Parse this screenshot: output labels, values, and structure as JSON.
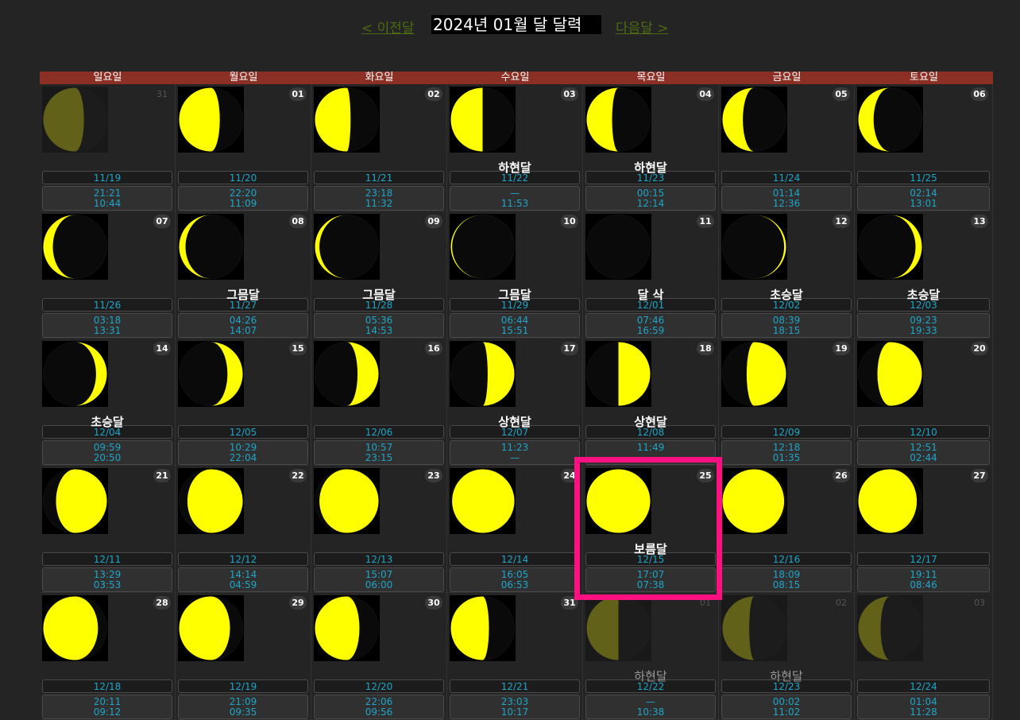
{
  "nav": {
    "prev_label": "< 이전달",
    "title": "2024년 01월 달 달력",
    "next_label": "다음달 >"
  },
  "colors": {
    "moon_lit": "#ffff00",
    "moon_dark": "#0a0a0a",
    "header_bg": "#8c3026",
    "text_accent": "#1fa5c7",
    "highlight": "#ff1080"
  },
  "weekdays": [
    "일요일",
    "월요일",
    "화요일",
    "수요일",
    "목요일",
    "금요일",
    "토요일"
  ],
  "weeks": [
    [
      {
        "day": "31",
        "other": true,
        "lunar": "11/19",
        "rise": "21:21",
        "set": "10:44",
        "phase": "",
        "lit": 0.64,
        "waxing": false
      },
      {
        "day": "01",
        "lunar": "11/20",
        "rise": "22:20",
        "set": "11:09",
        "phase": "",
        "lit": 0.64,
        "waxing": false
      },
      {
        "day": "02",
        "lunar": "11/21",
        "rise": "23:18",
        "set": "11:32",
        "phase": "",
        "lit": 0.56,
        "waxing": false
      },
      {
        "day": "03",
        "lunar": "11/22",
        "rise": "—",
        "set": "11:53",
        "phase": "하현달",
        "lit": 0.5,
        "waxing": false
      },
      {
        "day": "04",
        "lunar": "11/23",
        "rise": "00:15",
        "set": "12:14",
        "phase": "하현달",
        "lit": 0.4,
        "waxing": false
      },
      {
        "day": "05",
        "lunar": "11/24",
        "rise": "01:14",
        "set": "12:36",
        "phase": "",
        "lit": 0.32,
        "waxing": false
      },
      {
        "day": "06",
        "lunar": "11/25",
        "rise": "02:14",
        "set": "13:01",
        "phase": "",
        "lit": 0.24,
        "waxing": false
      }
    ],
    [
      {
        "day": "07",
        "lunar": "11/26",
        "rise": "03:18",
        "set": "13:31",
        "phase": "",
        "lit": 0.15,
        "waxing": false
      },
      {
        "day": "08",
        "lunar": "11/27",
        "rise": "04:26",
        "set": "14:07",
        "phase": "그믐달",
        "lit": 0.1,
        "waxing": false
      },
      {
        "day": "09",
        "lunar": "11/28",
        "rise": "05:36",
        "set": "14:53",
        "phase": "그믐달",
        "lit": 0.07,
        "waxing": false
      },
      {
        "day": "10",
        "lunar": "11/29",
        "rise": "06:44",
        "set": "15:51",
        "phase": "그믐달",
        "lit": 0.02,
        "waxing": false
      },
      {
        "day": "11",
        "lunar": "12/01",
        "rise": "07:46",
        "set": "16:59",
        "phase": "달 삭",
        "lit": 0,
        "waxing": true
      },
      {
        "day": "12",
        "lunar": "12/02",
        "rise": "08:39",
        "set": "18:15",
        "phase": "초승달",
        "lit": 0.03,
        "waxing": true
      },
      {
        "day": "13",
        "lunar": "12/03",
        "rise": "09:23",
        "set": "19:33",
        "phase": "초승달",
        "lit": 0.1,
        "waxing": true
      }
    ],
    [
      {
        "day": "14",
        "lunar": "12/04",
        "rise": "09:59",
        "set": "20:50",
        "phase": "초승달",
        "lit": 0.17,
        "waxing": true
      },
      {
        "day": "15",
        "lunar": "12/05",
        "rise": "10:29",
        "set": "22:04",
        "phase": "",
        "lit": 0.24,
        "waxing": true
      },
      {
        "day": "16",
        "lunar": "12/06",
        "rise": "10:57",
        "set": "23:15",
        "phase": "",
        "lit": 0.33,
        "waxing": true
      },
      {
        "day": "17",
        "lunar": "12/07",
        "rise": "11:23",
        "set": "—",
        "phase": "상현달",
        "lit": 0.42,
        "waxing": true
      },
      {
        "day": "18",
        "lunar": "12/08",
        "rise": "11:49",
        "set": "",
        "phase": "상현달",
        "lit": 0.5,
        "waxing": true
      },
      {
        "day": "19",
        "lunar": "12/09",
        "rise": "12:18",
        "set": "01:35",
        "phase": "",
        "lit": 0.62,
        "waxing": true
      },
      {
        "day": "20",
        "lunar": "12/10",
        "rise": "12:51",
        "set": "02:44",
        "phase": "",
        "lit": 0.7,
        "waxing": true
      }
    ],
    [
      {
        "day": "21",
        "lunar": "12/11",
        "rise": "13:29",
        "set": "03:53",
        "phase": "",
        "lit": 0.8,
        "waxing": true
      },
      {
        "day": "22",
        "lunar": "12/12",
        "rise": "14:14",
        "set": "04:59",
        "phase": "",
        "lit": 0.87,
        "waxing": true
      },
      {
        "day": "23",
        "lunar": "12/13",
        "rise": "15:07",
        "set": "06:00",
        "phase": "",
        "lit": 0.93,
        "waxing": true
      },
      {
        "day": "24",
        "lunar": "12/14",
        "rise": "16:05",
        "set": "06:53",
        "phase": "",
        "lit": 0.98,
        "waxing": true
      },
      {
        "day": "25",
        "lunar": "12/15",
        "rise": "17:07",
        "set": "07:38",
        "phase": "보름달",
        "lit": 1,
        "waxing": true
      },
      {
        "day": "26",
        "lunar": "12/16",
        "rise": "18:09",
        "set": "08:15",
        "phase": "",
        "lit": 0.97,
        "waxing": false
      },
      {
        "day": "27",
        "lunar": "12/17",
        "rise": "19:11",
        "set": "08:46",
        "phase": "",
        "lit": 0.92,
        "waxing": false
      }
    ],
    [
      {
        "day": "28",
        "lunar": "12/18",
        "rise": "20:11",
        "set": "09:12",
        "phase": "",
        "lit": 0.86,
        "waxing": false
      },
      {
        "day": "29",
        "lunar": "12/19",
        "rise": "21:09",
        "set": "09:35",
        "phase": "",
        "lit": 0.8,
        "waxing": false
      },
      {
        "day": "30",
        "lunar": "12/20",
        "rise": "22:06",
        "set": "09:56",
        "phase": "",
        "lit": 0.7,
        "waxing": false
      },
      {
        "day": "31",
        "lunar": "12/21",
        "rise": "23:03",
        "set": "10:17",
        "phase": "",
        "lit": 0.6,
        "waxing": false
      },
      {
        "day": "01",
        "other": true,
        "lunar": "12/22",
        "rise": "—",
        "set": "10:38",
        "phase": "하현달",
        "lit": 0.5,
        "waxing": false
      },
      {
        "day": "02",
        "other": true,
        "lunar": "12/23",
        "rise": "00:02",
        "set": "11:02",
        "phase": "하현달",
        "lit": 0.42,
        "waxing": false
      },
      {
        "day": "03",
        "other": true,
        "lunar": "12/24",
        "rise": "01:04",
        "set": "11:28",
        "phase": "",
        "lit": 0.35,
        "waxing": false
      }
    ]
  ]
}
